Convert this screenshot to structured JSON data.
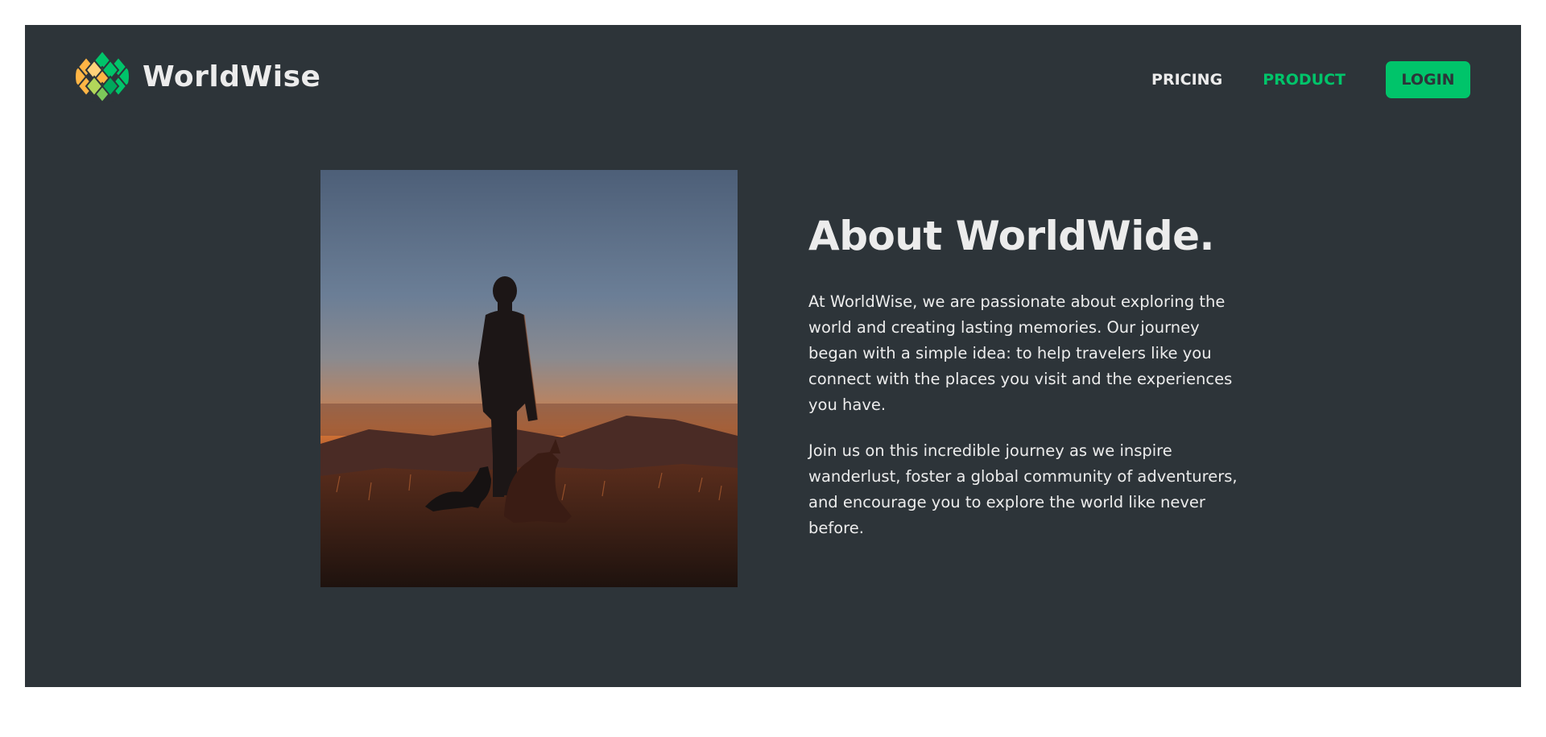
{
  "brand": {
    "name": "WorldWise",
    "logo_icon": "globe-hex-logo-icon",
    "colors": {
      "green": "#00c46a",
      "yellow": "#ffb545",
      "bg": "#2d3439",
      "text": "#ececec"
    }
  },
  "nav": {
    "links": [
      {
        "label": "PRICING",
        "active": false
      },
      {
        "label": "PRODUCT",
        "active": true
      }
    ],
    "login_label": "LOGIN"
  },
  "about": {
    "title": "About WorldWide.",
    "paragraphs": [
      "At WorldWise, we are passionate about exploring the world and creating lasting memories. Our journey began with a simple idea: to help travelers like you connect with the places you visit and the experiences you have.",
      "Join us on this incredible journey as we inspire wanderlust, foster a global community of adventurers, and encourage you to explore the world like never before."
    ]
  }
}
